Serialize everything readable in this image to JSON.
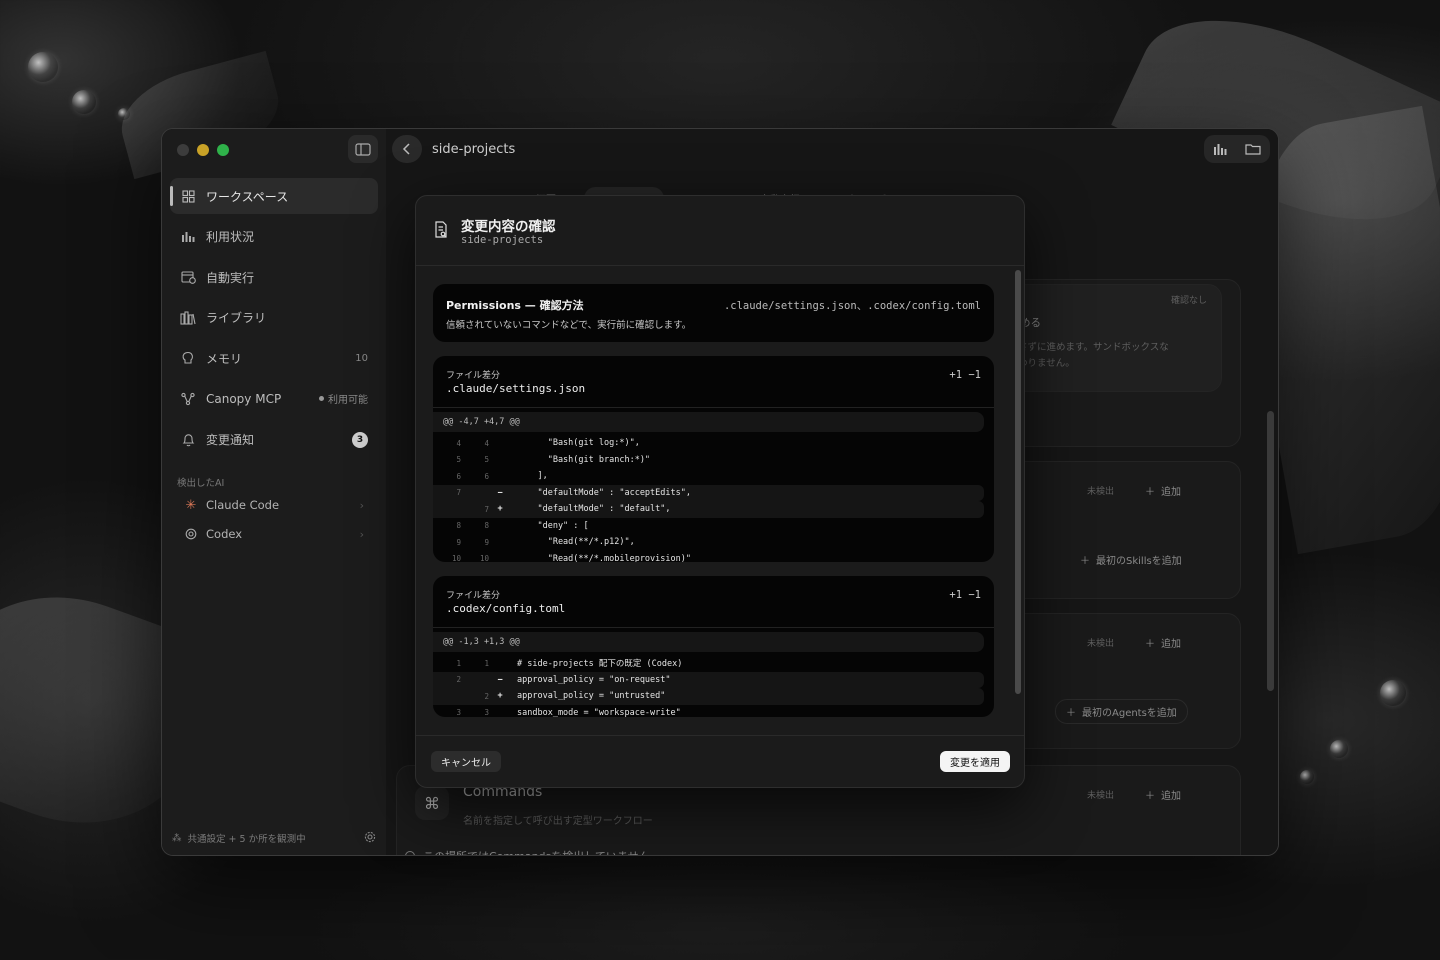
{
  "window": {
    "title": "side-projects"
  },
  "sidebar": {
    "items": [
      {
        "label": "ワークスペース",
        "icon": "grid-icon",
        "active": true
      },
      {
        "label": "利用状況",
        "icon": "bar-chart-icon"
      },
      {
        "label": "自動実行",
        "icon": "calendar-clock-icon"
      },
      {
        "label": "ライブラリ",
        "icon": "library-icon"
      },
      {
        "label": "メモリ",
        "icon": "brain-icon",
        "count": "10"
      },
      {
        "label": "Canopy MCP",
        "icon": "network-icon",
        "status": "利用可能"
      },
      {
        "label": "変更通知",
        "icon": "bell-icon",
        "badge": "3"
      }
    ],
    "section_label": "検出したAI",
    "ai": [
      {
        "label": "Claude Code",
        "icon": "claude-sparkle-icon"
      },
      {
        "label": "Codex",
        "icon": "openai-icon"
      }
    ],
    "footer": "共通設定 + 5 か所を観測中"
  },
  "background_content": {
    "tabs": [
      "概要",
      "コンテキスト",
      "メモリ",
      "自動実行",
      "アクティビティ"
    ],
    "permission_mode": {
      "badge": "確認なし",
      "title": "で進める",
      "desc1": "を出さずに進めます。サンドボックスな",
      "desc2": "は変わりません。"
    },
    "not_detected": "未検出",
    "add": "追加",
    "add_first_skill": "最初のSkillsを追加",
    "add_first_agent": "最初のAgentsを追加",
    "commands": {
      "title": "Commands",
      "desc": "名前を指定して呼び出す定型ワークフロー",
      "empty": "この場所ではCommandsを検出していません"
    }
  },
  "modal": {
    "title": "変更内容の確認",
    "subtitle": "side-projects",
    "permission": {
      "title": "Permissions — 確認方法",
      "files": ".claude/settings.json、.codex/config.toml",
      "desc": "信頼されていないコマンドなどで、実行前に確認します。"
    },
    "diffs": [
      {
        "label": "ファイル差分",
        "file": ".claude/settings.json",
        "stats": "+1 −1",
        "hunk": "@@ -4,7 +4,7 @@",
        "lines": [
          {
            "old": "4",
            "new": "4",
            "sign": "",
            "type": "ctx",
            "text": "      \"Bash(git log:*)\","
          },
          {
            "old": "5",
            "new": "5",
            "sign": "",
            "type": "ctx",
            "text": "      \"Bash(git branch:*)\""
          },
          {
            "old": "6",
            "new": "6",
            "sign": "",
            "type": "ctx",
            "text": "    ],"
          },
          {
            "old": "7",
            "new": "",
            "sign": "−",
            "type": "del",
            "text": "    \"defaultMode\" : \"acceptEdits\","
          },
          {
            "old": "",
            "new": "7",
            "sign": "+",
            "type": "add",
            "text": "    \"defaultMode\" : \"default\","
          },
          {
            "old": "8",
            "new": "8",
            "sign": "",
            "type": "ctx",
            "text": "    \"deny\" : ["
          },
          {
            "old": "9",
            "new": "9",
            "sign": "",
            "type": "ctx",
            "text": "      \"Read(**/*.p12)\","
          },
          {
            "old": "10",
            "new": "10",
            "sign": "",
            "type": "ctx",
            "text": "      \"Read(**/*.mobileprovision)\""
          }
        ]
      },
      {
        "label": "ファイル差分",
        "file": ".codex/config.toml",
        "stats": "+1 −1",
        "hunk": "@@ -1,3 +1,3 @@",
        "lines": [
          {
            "old": "1",
            "new": "1",
            "sign": "",
            "type": "ctx",
            "text": "# side-projects 配下の既定 (Codex)"
          },
          {
            "old": "2",
            "new": "",
            "sign": "−",
            "type": "del",
            "text": "approval_policy = \"on-request\""
          },
          {
            "old": "",
            "new": "2",
            "sign": "+",
            "type": "add",
            "text": "approval_policy = \"untrusted\""
          },
          {
            "old": "3",
            "new": "3",
            "sign": "",
            "type": "ctx",
            "text": "sandbox_mode = \"workspace-write\""
          }
        ]
      }
    ],
    "cancel": "キャンセル",
    "apply": "変更を適用"
  },
  "colors": {
    "close": "#ff5f57",
    "minimize": "#febc2e",
    "zoom": "#28c840",
    "claude": "#d97757"
  }
}
